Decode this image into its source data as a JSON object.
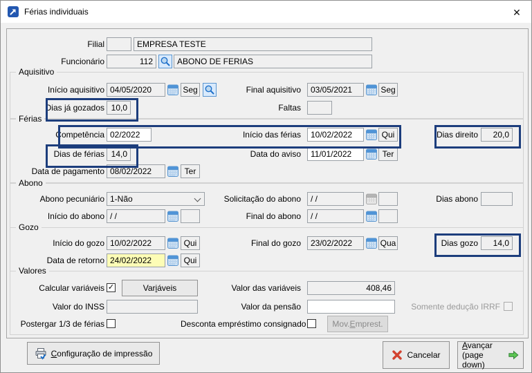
{
  "window": {
    "title": "Férias individuais",
    "close_glyph": "✕"
  },
  "colors": {
    "highlight": "#1c3d7c",
    "field_yellow": "#fdfdb6",
    "accent_blue": "#2257b0"
  },
  "header": {
    "filial": {
      "label": "Filial",
      "code": "",
      "name": "EMPRESA TESTE"
    },
    "funcionario": {
      "label": "Funcionário",
      "code": "112",
      "name": "ABONO DE FERIAS"
    }
  },
  "aquisitivo": {
    "legend": "Aquisitivo",
    "inicio": {
      "label": "Início aquisitivo",
      "value": "04/05/2020",
      "dow": "Seg"
    },
    "final": {
      "label": "Final aquisitivo",
      "value": "03/05/2021",
      "dow": "Seg"
    },
    "dias_ja_gozados": {
      "label": "Dias já gozados",
      "value": "10,0"
    },
    "faltas": {
      "label": "Faltas",
      "value": ""
    }
  },
  "ferias": {
    "legend": "Férias",
    "competencia": {
      "label": "Competência",
      "value": "02/2022"
    },
    "inicio": {
      "label": "Início das férias",
      "value": "10/02/2022",
      "dow": "Qui"
    },
    "dias_direito": {
      "label": "Dias direito",
      "value": "20,0"
    },
    "dias_ferias": {
      "label": "Dias de férias",
      "value": "14,0"
    },
    "aviso": {
      "label": "Data do aviso",
      "value": "11/01/2022",
      "dow": "Ter"
    },
    "pagamento": {
      "label": "Data de pagamento",
      "value": "08/02/2022",
      "dow": "Ter"
    }
  },
  "abono": {
    "legend": "Abono",
    "pecuniario": {
      "label": "Abono pecuniário",
      "value": "1-Não"
    },
    "solicitacao": {
      "label": "Solicitação do abono",
      "value": "/  /",
      "dow": ""
    },
    "dias_abono": {
      "label": "Dias abono",
      "value": ""
    },
    "inicio": {
      "label": "Início do abono",
      "value": "/  /",
      "dow": ""
    },
    "final": {
      "label": "Final do abono",
      "value": "/  /",
      "dow": ""
    }
  },
  "gozo": {
    "legend": "Gozo",
    "inicio": {
      "label": "Início do gozo",
      "value": "10/02/2022",
      "dow": "Qui"
    },
    "final": {
      "label": "Final do gozo",
      "value": "23/02/2022",
      "dow": "Qua"
    },
    "dias_gozo": {
      "label": "Dias gozo",
      "value": "14,0"
    },
    "retorno": {
      "label": "Data de retorno",
      "value": "24/02/2022",
      "dow": "Qui"
    }
  },
  "valores": {
    "legend": "Valores",
    "calcular_variaveis": {
      "label": "Calcular variáveis",
      "mark": "✓"
    },
    "variaveis_btn": {
      "pre": "Var",
      "accel": "i",
      "post": "áveis"
    },
    "valor_variaveis": {
      "label": "Valor das variáveis",
      "value": "408,46"
    },
    "valor_inss": {
      "label": "Valor do INSS",
      "value": ""
    },
    "valor_pensao": {
      "label": "Valor da pensão",
      "value": ""
    },
    "somente_irrf": {
      "label": "Somente dedução IRRF",
      "mark": ""
    },
    "postergar": {
      "label": "Postergar 1/3 de férias",
      "mark": ""
    },
    "desconta": {
      "label": "Desconta empréstimo consignado",
      "mark": ""
    },
    "mov_emprest_btn": {
      "pre": "Mov.",
      "accel": "E",
      "post": "mprest."
    }
  },
  "footer": {
    "config_impressao": {
      "pre": "",
      "accel": "C",
      "post": "onfiguração de impressão"
    },
    "cancelar": "Cancelar",
    "avancar": {
      "pre": "",
      "accel": "A",
      "post": "vançar",
      "line2": "(page down)"
    }
  }
}
